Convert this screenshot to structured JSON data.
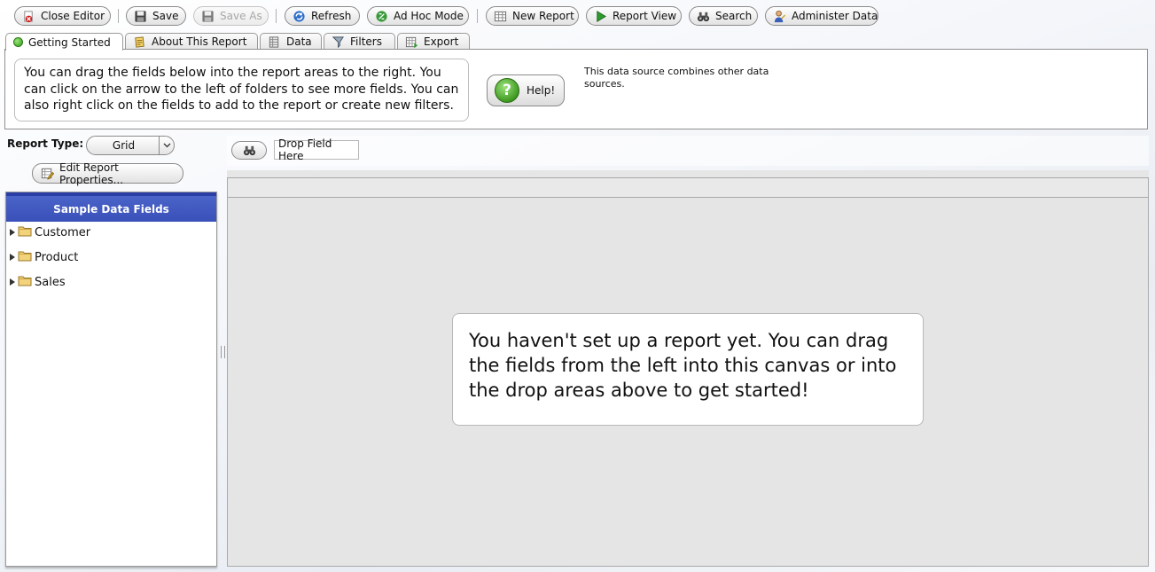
{
  "toolbar": {
    "close_editor": "Close Editor",
    "save": "Save",
    "save_as": "Save As",
    "refresh": "Refresh",
    "ad_hoc_mode": "Ad Hoc Mode",
    "new_report": "New Report",
    "report_view": "Report View",
    "search": "Search",
    "administer_data": "Administer Data"
  },
  "tabs": [
    {
      "label": "Getting Started",
      "icon": "green-dot-icon",
      "active": true
    },
    {
      "label": "About This Report",
      "icon": "notepad-icon"
    },
    {
      "label": "Data",
      "icon": "database-icon"
    },
    {
      "label": "Filters",
      "icon": "funnel-icon"
    },
    {
      "label": "Export",
      "icon": "export-grid-icon"
    }
  ],
  "getting_started": {
    "intro": "You can drag the fields below into the report areas to the right. You can click on the arrow to the left of folders to see more fields. You can also right click on the fields to add to the report or create new filters.",
    "help_label": "Help!",
    "datasource_note": "This data source combines other data sources."
  },
  "report_type": {
    "label": "Report Type:",
    "value": "Grid"
  },
  "edit_properties_label": "Edit Report Properties...",
  "fields_panel": {
    "title": "Sample Data Fields",
    "folders": [
      "Customer",
      "Product",
      "Sales"
    ]
  },
  "drop_area": {
    "placeholder": "Drop Field Here"
  },
  "canvas": {
    "message": "You haven't set up a report yet. You can drag the fields from the left into this canvas or into the drop areas above to get started!"
  }
}
